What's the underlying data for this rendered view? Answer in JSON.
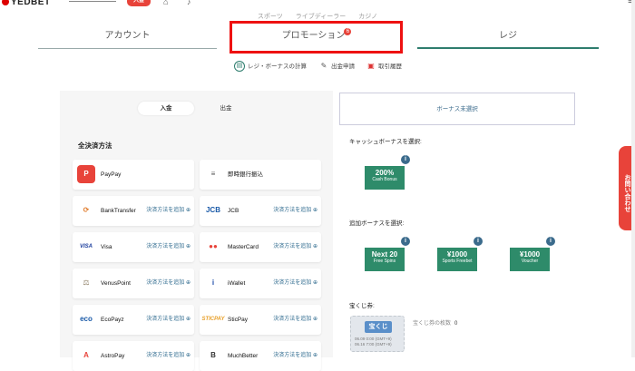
{
  "header": {
    "logo": "YEDBET",
    "red_button": "入金",
    "top_menu": [
      "スポーツ",
      "ライブディーラー",
      "カジノ"
    ]
  },
  "tabs": [
    {
      "label": "アカウント"
    },
    {
      "label": "プロモーション",
      "badge": "6"
    },
    {
      "label": "レジ"
    }
  ],
  "subnav": [
    {
      "label": "レジ・ボーナスの計算",
      "icon": "calculator-icon"
    },
    {
      "label": "出金申請",
      "icon": "edit-icon"
    },
    {
      "label": "取引履歴",
      "icon": "wallet-icon"
    }
  ],
  "payment": {
    "segment": {
      "deposit": "入金",
      "withdraw": "出金"
    },
    "section_title": "全決済方法",
    "add_label": "決済方法を追加 ⊕",
    "methods": [
      {
        "name": "PayPay",
        "logo": "P",
        "color": "#e8433a",
        "add": false
      },
      {
        "name": "即時銀行振込",
        "logo": "≡",
        "color": "#555555",
        "add": false
      },
      {
        "name": "BankTransfer",
        "logo": "⟳",
        "color": "#e07a2a",
        "add": true
      },
      {
        "name": "JCB",
        "logo": "JCB",
        "color": "#1a5aa8",
        "add": true
      },
      {
        "name": "Visa",
        "logo": "VISA",
        "color": "#1a3c9c",
        "add": true
      },
      {
        "name": "MasterCard",
        "logo": "●●",
        "color": "#e8433a",
        "add": true
      },
      {
        "name": "VenusPoint",
        "logo": "⚖",
        "color": "#8a7a60",
        "add": true
      },
      {
        "name": "iWallet",
        "logo": "i",
        "color": "#1a4aa8",
        "add": true
      },
      {
        "name": "EcoPayz",
        "logo": "eco",
        "color": "#1a5aa8",
        "add": true
      },
      {
        "name": "SticPay",
        "logo": "STICPAY",
        "color": "#e8a02a",
        "add": true
      },
      {
        "name": "AstroPay",
        "logo": "A",
        "color": "#e8433a",
        "add": true
      },
      {
        "name": "MuchBetter",
        "logo": "B",
        "color": "#333333",
        "add": true
      }
    ]
  },
  "bonus": {
    "box_label": "ボーナス未選択",
    "cash_label": "キャッシュボーナスを選択:",
    "cash": [
      {
        "big": "200%",
        "small": "Cash Bonus"
      }
    ],
    "extra_label": "追加ボーナスを選択:",
    "extra": [
      {
        "big": "Next 20",
        "small": "Free Spins"
      },
      {
        "big": "¥1000",
        "small": "Sports Freebet"
      },
      {
        "big": "¥1000",
        "small": "Voucher"
      }
    ],
    "lottery_label": "宝くじ券:",
    "lottery_ticket": "宝くじ",
    "lottery_dates": "06.09 0:00 (GMT+9)\n06.16 7:00 (GMT+9)",
    "lottery_count_label": "宝くじ券の枚数",
    "lottery_count": "0"
  },
  "contact": "お問い合わせ",
  "colors": {
    "accent": "#2e7d6e",
    "brand_red": "#e8433a",
    "highlight": "#ee1111"
  }
}
